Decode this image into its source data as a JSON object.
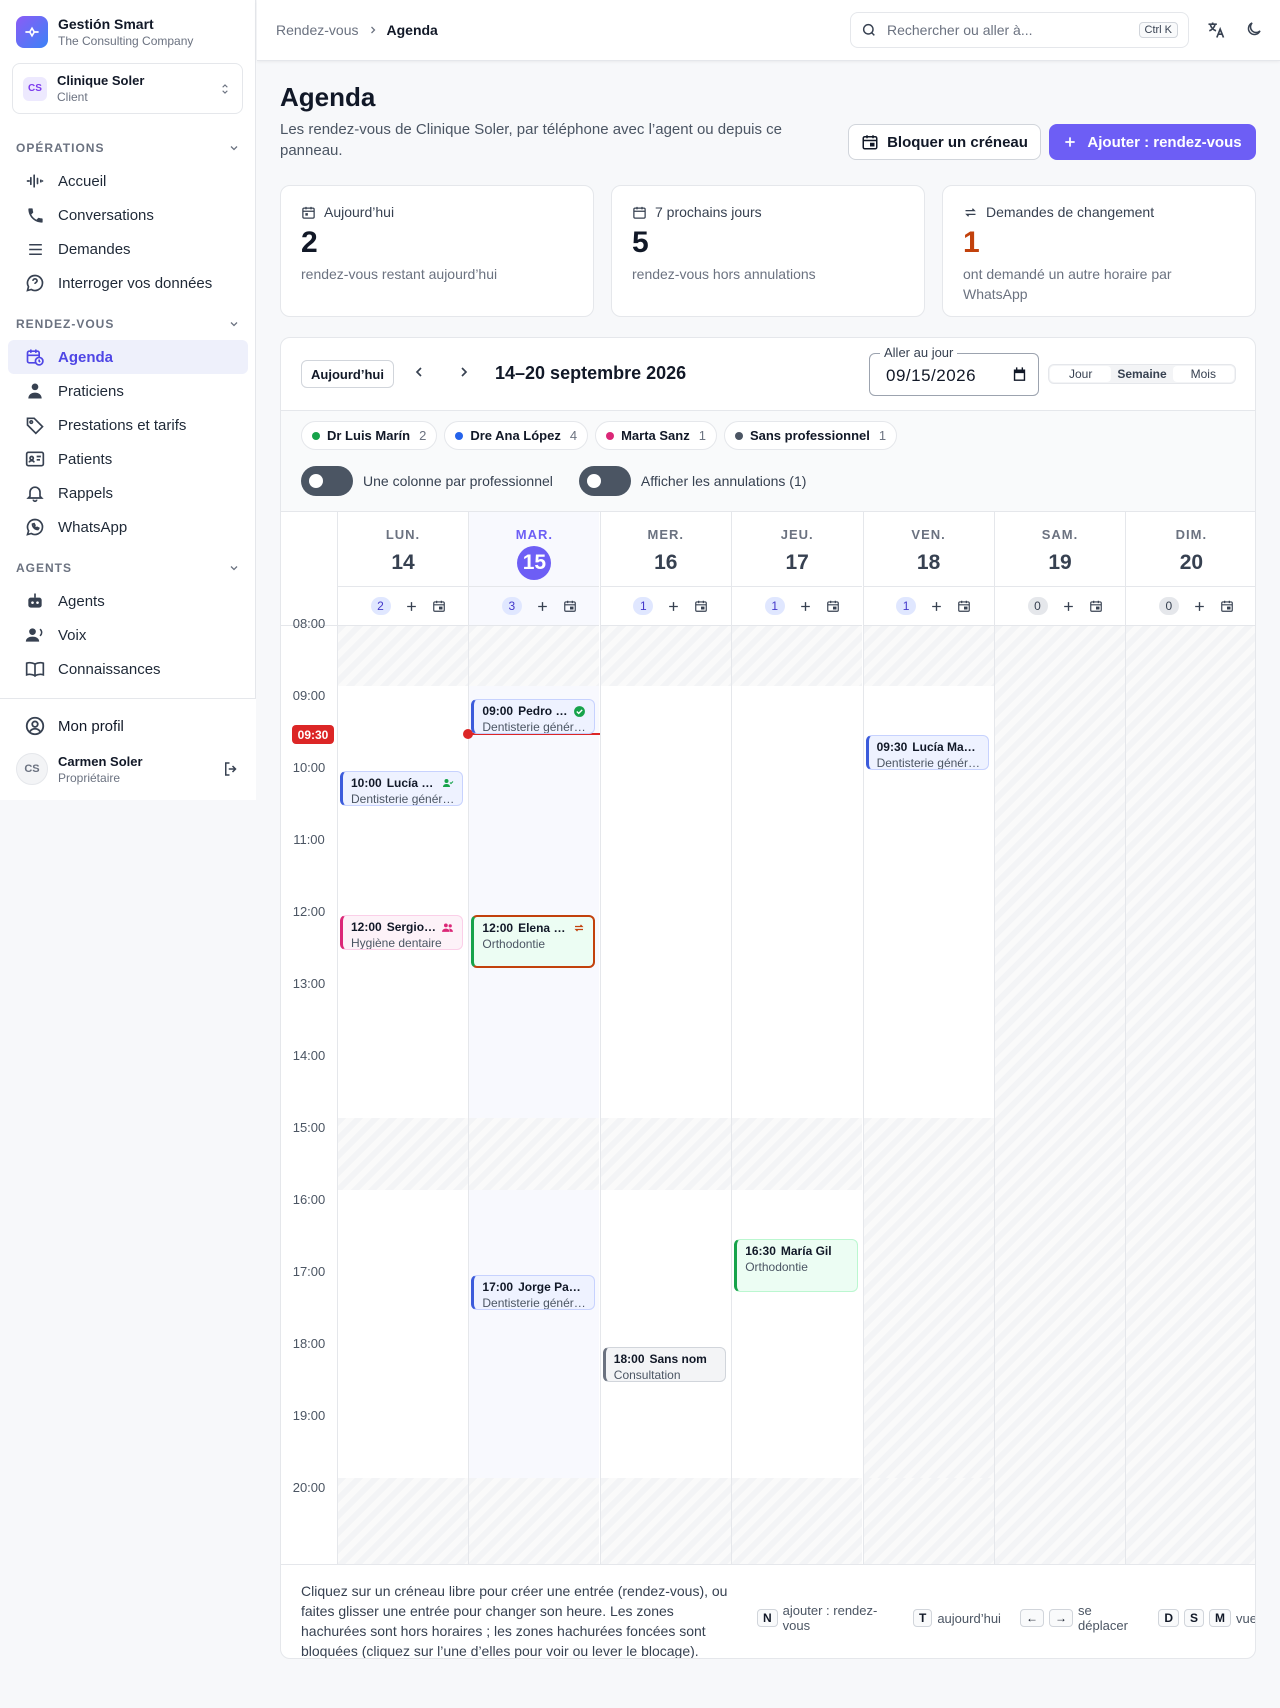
{
  "app": {
    "name": "Gestión Smart",
    "company": "The Consulting Company"
  },
  "org": {
    "initials": "CS",
    "name": "Clinique Soler",
    "role": "Client"
  },
  "nav": {
    "sections": [
      {
        "title": "OPÉRATIONS",
        "items": [
          {
            "label": "Accueil",
            "icon": "waveform-icon"
          },
          {
            "label": "Conversations",
            "icon": "phone-icon"
          },
          {
            "label": "Demandes",
            "icon": "inbox-stack-icon"
          },
          {
            "label": "Interroger vos données",
            "icon": "chat-question-icon"
          }
        ]
      },
      {
        "title": "RENDEZ-VOUS",
        "items": [
          {
            "label": "Agenda",
            "icon": "calendar-clock-icon",
            "active": true
          },
          {
            "label": "Praticiens",
            "icon": "doctor-icon"
          },
          {
            "label": "Prestations et tarifs",
            "icon": "price-tag-icon"
          },
          {
            "label": "Patients",
            "icon": "id-card-icon"
          },
          {
            "label": "Rappels",
            "icon": "bell-icon"
          },
          {
            "label": "WhatsApp",
            "icon": "whatsapp-icon"
          }
        ]
      },
      {
        "title": "AGENTS",
        "items": [
          {
            "label": "Agents",
            "icon": "robot-icon"
          },
          {
            "label": "Voix",
            "icon": "voice-person-icon"
          },
          {
            "label": "Connaissances",
            "icon": "book-icon"
          }
        ]
      }
    ]
  },
  "sidebar_footer": {
    "profile": "Mon profil",
    "user_initials": "CS",
    "user_name": "Carmen Soler",
    "user_role": "Propriétaire"
  },
  "topbar": {
    "breadcrumb": [
      "Rendez-vous",
      "Agenda"
    ],
    "search_placeholder": "Rechercher ou aller à...",
    "search_shortcut": "Ctrl K"
  },
  "page": {
    "title": "Agenda",
    "description": "Les rendez-vous de Clinique Soler, par téléphone avec l’agent ou depuis ce panneau.",
    "btn_block": "Bloquer un créneau",
    "btn_add": "Ajouter : rendez-vous"
  },
  "stats": [
    {
      "label": "Aujourd’hui",
      "value": "2",
      "sub": "rendez-vous restant aujourd’hui",
      "icon": "calendar-today-icon"
    },
    {
      "label": "7 prochains jours",
      "value": "5",
      "sub": "rendez-vous hors annulations",
      "icon": "calendar-icon"
    },
    {
      "label": "Demandes de changement",
      "value": "1",
      "sub": "ont demandé un autre horaire par WhatsApp",
      "icon": "swap-icon",
      "value_color": "#c2410c"
    }
  ],
  "calendar": {
    "today_btn": "Aujourd’hui",
    "range": "14–20 septembre 2026",
    "date_label": "Aller au jour",
    "date_value": "09/15/2026",
    "views": [
      "Jour",
      "Semaine",
      "Mois"
    ],
    "active_view": "Semaine",
    "practitioners": [
      {
        "name": "Dr Luis Marín",
        "count": "2",
        "color": "#16a34a"
      },
      {
        "name": "Dre Ana López",
        "count": "4",
        "color": "#2563eb"
      },
      {
        "name": "Marta Sanz",
        "count": "1",
        "color": "#db2777"
      },
      {
        "name": "Sans professionnel",
        "count": "1",
        "color": "#4b5563"
      }
    ],
    "toggle_columns": "Une colonne par professionnel",
    "toggle_cancelled": "Afficher les annulations (1)",
    "days": [
      {
        "name": "LUN.",
        "num": "14",
        "count": "2"
      },
      {
        "name": "MAR.",
        "num": "15",
        "count": "3",
        "today": true
      },
      {
        "name": "MER.",
        "num": "16",
        "count": "1"
      },
      {
        "name": "JEU.",
        "num": "17",
        "count": "1"
      },
      {
        "name": "VEN.",
        "num": "18",
        "count": "1"
      },
      {
        "name": "SAM.",
        "num": "19",
        "count": "0"
      },
      {
        "name": "DIM.",
        "num": "20",
        "count": "0"
      }
    ],
    "hours": [
      "08:00",
      "09:00",
      "10:00",
      "11:00",
      "12:00",
      "13:00",
      "14:00",
      "15:00",
      "16:00",
      "17:00",
      "18:00",
      "19:00",
      "20:00"
    ],
    "now": "09:30",
    "events": [
      {
        "day": 0,
        "start": "10:00",
        "end": "10:30",
        "time": "10:00",
        "name": "Lucía Martín",
        "service": "Dentisterie générale",
        "color": "blue",
        "icon": "person-check-icon"
      },
      {
        "day": 0,
        "start": "12:00",
        "end": "12:30",
        "time": "12:00",
        "name": "Sergio Ruiz",
        "service": "Hygiène dentaire",
        "color": "pink",
        "icon": "people-icon"
      },
      {
        "day": 1,
        "start": "09:00",
        "end": "09:30",
        "time": "09:00",
        "name": "Pedro Gómez",
        "service": "Dentisterie générale",
        "color": "blue",
        "icon": "check-circle-icon"
      },
      {
        "day": 1,
        "start": "12:00",
        "end": "12:45",
        "time": "12:00",
        "name": "Elena Rodríguez",
        "service": "Orthodontie",
        "color": "green ring",
        "icon": "swap-icon"
      },
      {
        "day": 1,
        "start": "17:00",
        "end": "17:30",
        "time": "17:00",
        "name": "Jorge Pascual",
        "service": "Dentisterie générale",
        "color": "blue",
        "icon": ""
      },
      {
        "day": 2,
        "start": "18:00",
        "end": "18:30",
        "time": "18:00",
        "name": "Sans nom",
        "service": "Consultation",
        "color": "gray",
        "icon": ""
      },
      {
        "day": 3,
        "start": "16:30",
        "end": "17:15",
        "time": "16:30",
        "name": "María Gil",
        "service": "Orthodontie",
        "color": "green",
        "icon": ""
      },
      {
        "day": 4,
        "start": "09:30",
        "end": "10:00",
        "time": "09:30",
        "name": "Lucía Martín",
        "service": "Dentisterie générale",
        "color": "blue",
        "icon": ""
      }
    ],
    "footer_help": "Cliquez sur un créneau libre pour créer une entrée (rendez-vous), ou faites glisser une entrée pour changer son heure. Les zones hachurées sont hors horaires ; les zones hachurées foncées sont bloquées (cliquez sur l’une d’elles pour voir ou lever le blocage).",
    "shortcuts": [
      {
        "keys": [
          "N"
        ],
        "label": "ajouter : rendez-vous"
      },
      {
        "keys": [
          "T"
        ],
        "label": "aujourd’hui"
      },
      {
        "keys": [
          "←",
          "→"
        ],
        "label": "se déplacer"
      },
      {
        "keys": [
          "D",
          "S",
          "M"
        ],
        "label": "vue"
      }
    ]
  },
  "colors": {
    "accent": "#6d5ef5",
    "now": "#dc2626"
  }
}
